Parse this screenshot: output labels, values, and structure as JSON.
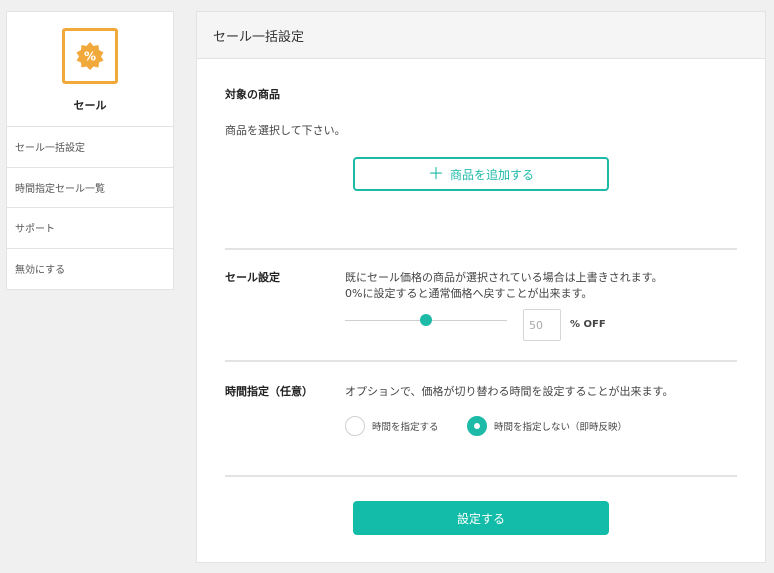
{
  "sidebar": {
    "app_name": "セール",
    "icon": "percent-badge-icon",
    "items": [
      {
        "label": "セール一括設定"
      },
      {
        "label": "時間指定セール一覧"
      },
      {
        "label": "サポート"
      },
      {
        "label": "無効にする"
      }
    ]
  },
  "panel": {
    "title": "セール一括設定",
    "products": {
      "heading": "対象の商品",
      "hint": "商品を選択して下さい。",
      "add_button": "商品を追加する"
    },
    "sale_settings": {
      "heading": "セール設定",
      "note1": "既にセール価格の商品が選択されている場合は上書きされます。",
      "note2": "0%に設定すると通常価格へ戻すことが出来ます。",
      "discount_value": "50",
      "discount_fraction": 0.5,
      "unit": "% OFF"
    },
    "time_settings": {
      "heading": "時間指定（任意）",
      "note": "オプションで、価格が切り替わる時間を設定することが出来ます。",
      "options": [
        {
          "label": "時間を指定する",
          "selected": false
        },
        {
          "label": "時間を指定しない（即時反映）",
          "selected": true
        }
      ]
    },
    "submit_button": "設定する"
  },
  "colors": {
    "accent": "#1dbaa8",
    "icon_orange": "#f2a93b"
  }
}
